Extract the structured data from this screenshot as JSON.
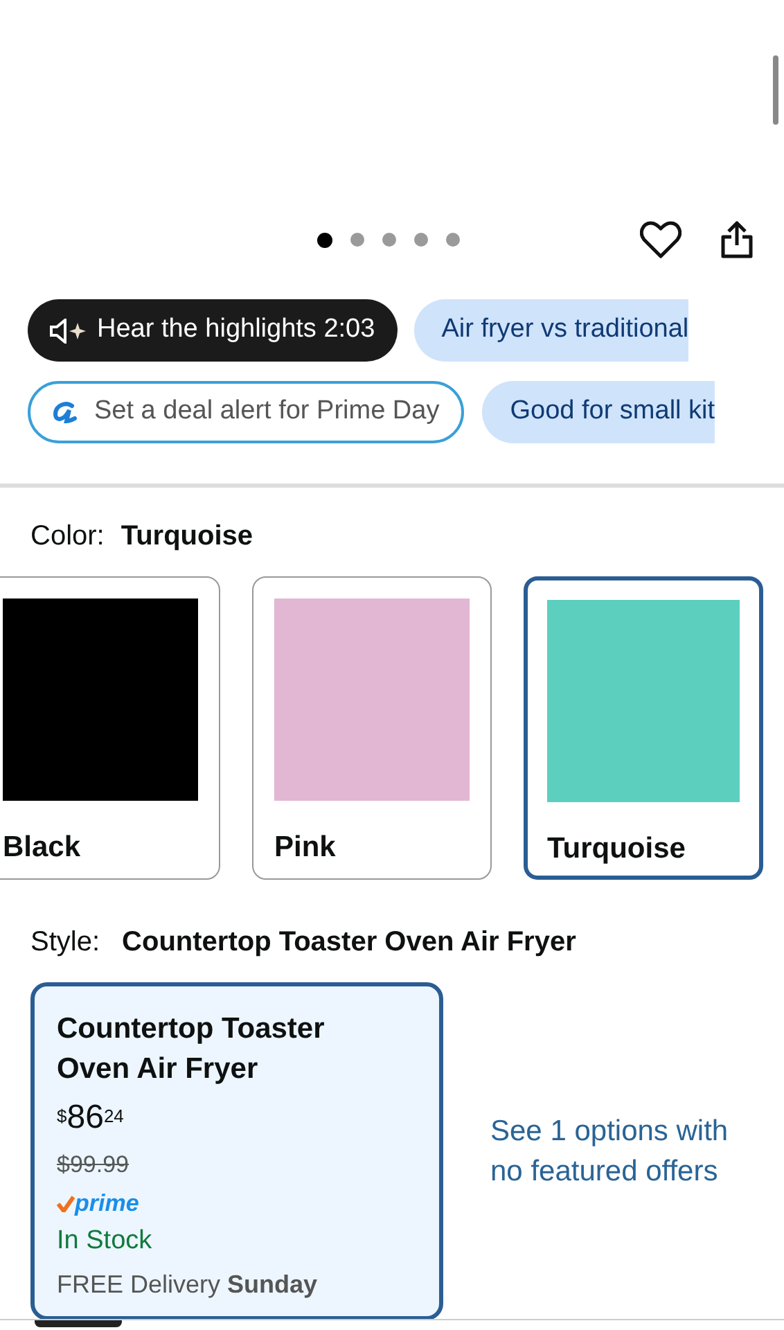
{
  "gallery": {
    "dots": [
      {
        "selected": true
      },
      {
        "selected": false
      },
      {
        "selected": false
      },
      {
        "selected": false
      },
      {
        "selected": false
      }
    ]
  },
  "chips": [
    {
      "kind": "audio",
      "label": "Hear the highlights 2:03"
    },
    {
      "kind": "topic",
      "label": "Air fryer vs traditional"
    },
    {
      "kind": "alert",
      "label": "Set a deal alert for Prime Day"
    },
    {
      "kind": "topic",
      "label": "Good for small kit"
    }
  ],
  "color": {
    "label": "Color:",
    "value": "Turquoise",
    "swatches": [
      {
        "name": "Black",
        "color": "#000000",
        "selected": false
      },
      {
        "name": "Pink",
        "color": "#e2b7d3",
        "selected": false
      },
      {
        "name": "Turquoise",
        "color": "#5ccfbf",
        "selected": true
      }
    ]
  },
  "style": {
    "label": "Style:",
    "value": "Countertop Toaster Oven Air Fryer",
    "option": {
      "title": "Countertop Toaster Oven Air Fryer",
      "currency": "$",
      "price_whole": "86",
      "price_fraction": "24",
      "list_price": "$99.99",
      "prime": "prime",
      "stock": "In Stock",
      "delivery": "FREE Delivery **Sunday**",
      "selected": true
    },
    "link": "See 1 options with no featured offers"
  }
}
